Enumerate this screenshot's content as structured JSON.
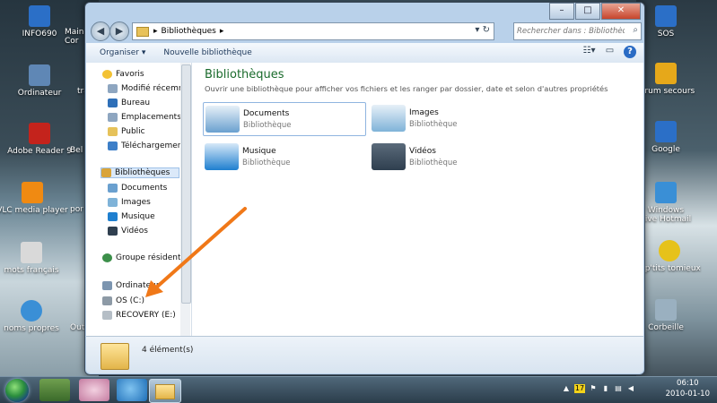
{
  "desktop": {
    "left_icons": [
      {
        "label": "INFO690",
        "color": "#2b6fc7"
      },
      {
        "label": "Ordinateur",
        "color": "#5f87b5"
      },
      {
        "label": "Adobe Reader 9",
        "color": "#c4231c"
      },
      {
        "label": "VLC media player",
        "color": "#f08a12"
      },
      {
        "label": "mots français",
        "color": "#d9d9d9"
      },
      {
        "label": "noms propres",
        "color": "#3a8fd6"
      }
    ],
    "partial_labels": [
      "Main",
      "Cor",
      "tra",
      "Bel",
      "por",
      "Out"
    ],
    "right_icons": [
      {
        "label": "SOS",
        "color": "#2b6fc7"
      },
      {
        "label": "forum secours",
        "color": "#e6a81a"
      },
      {
        "label": "Google",
        "color": "#2b6fc7"
      },
      {
        "label": "Windows Live Hotmail",
        "color": "#3a8fd6"
      },
      {
        "label": "s p'tits tomieux",
        "color": "#e6c21a"
      },
      {
        "label": "Corbeille",
        "color": "#9ab0c0"
      }
    ]
  },
  "window": {
    "title_buttons": {
      "minimize": "–",
      "maximize": "□",
      "close": "✕"
    },
    "address": {
      "path": "Bibliothèques",
      "separator": "▸"
    },
    "search": {
      "placeholder": "Rechercher dans : Bibliothèques"
    },
    "toolbar": {
      "organize": "Organiser ▾",
      "new_library": "Nouvelle bibliothèque"
    },
    "nav": {
      "favorites_header": "Favoris",
      "favorites": [
        "Modifié récemment",
        "Bureau",
        "Emplacements réc",
        "Public",
        "Téléchargements"
      ],
      "libraries_header": "Bibliothèques",
      "libraries": [
        "Documents",
        "Images",
        "Musique",
        "Vidéos"
      ],
      "homegroup": "Groupe résidentiel",
      "computer_header": "Ordinateur",
      "drives": [
        "OS (C:)",
        "RECOVERY (E:)"
      ]
    },
    "main": {
      "title": "Bibliothèques",
      "subtitle": "Ouvrir une bibliothèque pour afficher vos fichiers et les ranger par dossier, date et selon d'autres propriétés",
      "libraries": [
        {
          "name": "Documents",
          "type": "Bibliothèque",
          "color": "#6aa0cf"
        },
        {
          "name": "Images",
          "type": "Bibliothèque",
          "color": "#7fb3d8"
        },
        {
          "name": "Musique",
          "type": "Bibliothèque",
          "color": "#1f7fcf"
        },
        {
          "name": "Vidéos",
          "type": "Bibliothèque",
          "color": "#2f3f4f"
        }
      ]
    },
    "details": {
      "count": "4 élément(s)"
    }
  },
  "taskbar": {
    "time": "06:10",
    "date": "2010-01-10",
    "tray_badge": "17"
  },
  "colors": {
    "arrow": "#f07818",
    "title_green": "#1a6b2c"
  }
}
